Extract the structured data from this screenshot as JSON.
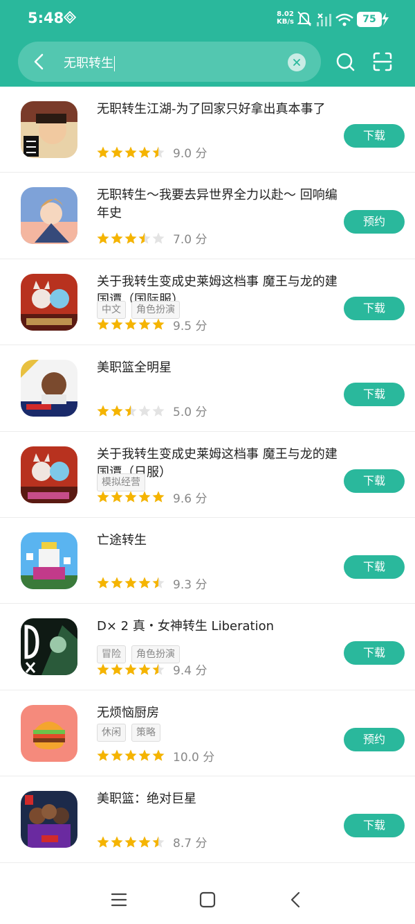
{
  "status_bar": {
    "time": "5:48",
    "speed_value": "8.02",
    "speed_unit": "KB/s",
    "battery": "75"
  },
  "search": {
    "query": "无职转生"
  },
  "results": [
    {
      "title": "无职转生江湖-为了回家只好拿出真本事了",
      "tags": [],
      "rating": 4.5,
      "score": "9.0 分",
      "action": "下载",
      "icon": "ronin-warrior-icon"
    },
    {
      "title": "无职转生～我要去异世界全力以赴～ 回响编年史",
      "tags": [],
      "rating": 3.5,
      "score": "7.0 分",
      "action": "预约",
      "icon": "anime-hero-icon"
    },
    {
      "title": "关于我转生变成史莱姆这档事 魔王与龙的建国谭（国际服）",
      "tags": [
        "中文",
        "角色扮演"
      ],
      "rating": 5,
      "score": "9.5 分",
      "action": "下载",
      "icon": "slime-anime-icon"
    },
    {
      "title": "美职篮全明星",
      "tags": [],
      "rating": 2.5,
      "score": "5.0 分",
      "action": "下载",
      "icon": "basketball-allstar-icon"
    },
    {
      "title": "关于我转生变成史莱姆这档事 魔王与龙的建国谭（日服）",
      "tags": [
        "模拟经营"
      ],
      "rating": 5,
      "score": "9.6 分",
      "action": "下载",
      "icon": "slime-anime-jp-icon"
    },
    {
      "title": "亡途转生",
      "tags": [],
      "rating": 4.5,
      "score": "9.3 分",
      "action": "下载",
      "icon": "pixel-king-icon"
    },
    {
      "title": "D× 2 真・女神转生 Liberation",
      "tags": [
        "冒险",
        "角色扮演"
      ],
      "rating": 4.5,
      "score": "9.4 分",
      "action": "下载",
      "icon": "dx2-icon"
    },
    {
      "title": "无烦恼厨房",
      "tags": [
        "休闲",
        "策略"
      ],
      "rating": 5,
      "score": "10.0 分",
      "action": "预约",
      "icon": "burger-icon"
    },
    {
      "title": "美职篮：绝对巨星",
      "tags": [],
      "rating": 4.5,
      "score": "8.7 分",
      "action": "下载",
      "icon": "basketball-superstar-icon"
    }
  ],
  "colors": {
    "accent": "#2ab89c",
    "star": "#f5b400",
    "star_empty": "#e3e3e3"
  }
}
